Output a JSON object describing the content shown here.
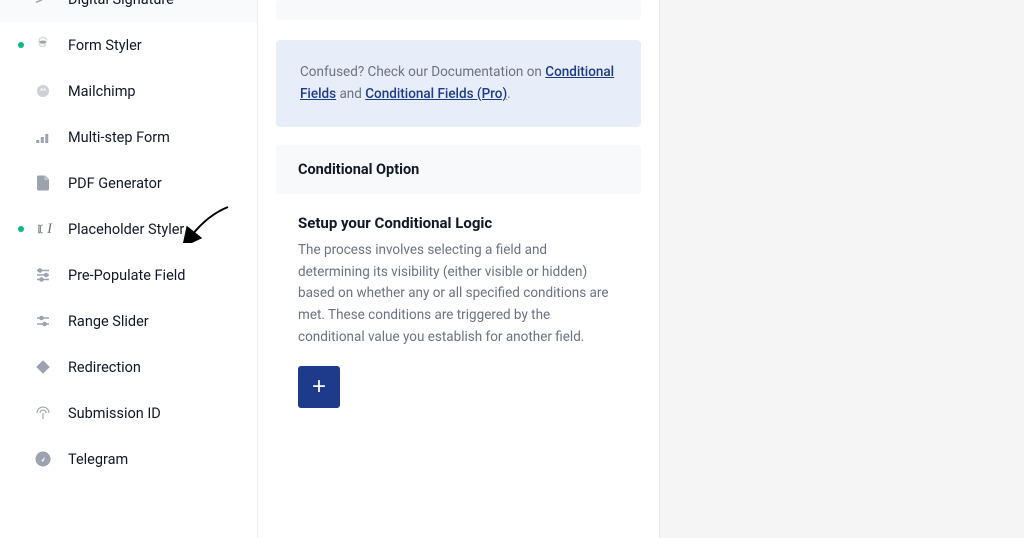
{
  "sidebar": {
    "items": [
      {
        "label": "Digital Signature",
        "icon": "signature-icon",
        "active": false,
        "visible_partial": true
      },
      {
        "label": "Form Styler",
        "icon": "form-styler-icon",
        "active": true
      },
      {
        "label": "Mailchimp",
        "icon": "mailchimp-icon",
        "active": false
      },
      {
        "label": "Multi-step Form",
        "icon": "steps-icon",
        "active": false
      },
      {
        "label": "PDF Generator",
        "icon": "pdf-icon",
        "active": false
      },
      {
        "label": "Placeholder Styler",
        "icon": "cursor-icon",
        "active": true
      },
      {
        "label": "Pre-Populate Field",
        "icon": "sliders-icon",
        "active": false
      },
      {
        "label": "Range Slider",
        "icon": "adjust-icon",
        "active": false
      },
      {
        "label": "Redirection",
        "icon": "diamond-icon",
        "active": false
      },
      {
        "label": "Submission ID",
        "icon": "fingerprint-icon",
        "active": false
      },
      {
        "label": "Telegram",
        "icon": "telegram-icon",
        "active": false
      }
    ]
  },
  "notice": {
    "prefix": "Confused? Check our Documentation on ",
    "link1": "Conditional Fields",
    "middle": " and ",
    "link2": "Conditional Fields (Pro)",
    "suffix": "."
  },
  "section": {
    "header": "Conditional Option",
    "title": "Setup your Conditional Logic",
    "description": "The process involves selecting a field and determining its visibility (either visible or hidden) based on whether any or all specified conditions are met. These conditions are triggered by the conditional value you establish for another field.",
    "add_label": "+"
  }
}
